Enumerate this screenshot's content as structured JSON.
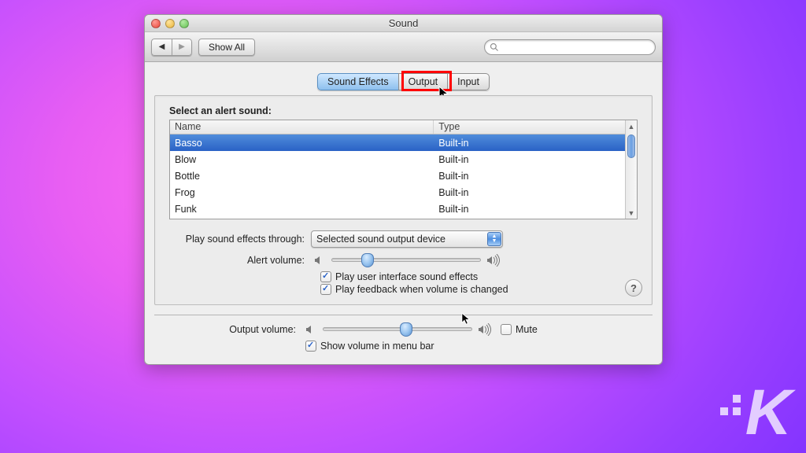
{
  "window": {
    "title": "Sound"
  },
  "toolbar": {
    "show_all": "Show All",
    "search_placeholder": ""
  },
  "tabs": {
    "items": [
      {
        "label": "Sound Effects",
        "active": true
      },
      {
        "label": "Output",
        "active": false
      },
      {
        "label": "Input",
        "active": false
      }
    ]
  },
  "section": {
    "alert_heading": "Select an alert sound:"
  },
  "columns": {
    "name": "Name",
    "type": "Type"
  },
  "alerts": [
    {
      "name": "Basso",
      "type": "Built-in",
      "selected": true
    },
    {
      "name": "Blow",
      "type": "Built-in",
      "selected": false
    },
    {
      "name": "Bottle",
      "type": "Built-in",
      "selected": false
    },
    {
      "name": "Frog",
      "type": "Built-in",
      "selected": false
    },
    {
      "name": "Funk",
      "type": "Built-in",
      "selected": false
    }
  ],
  "labels": {
    "play_through": "Play sound effects through:",
    "alert_volume": "Alert volume:",
    "output_volume": "Output volume:"
  },
  "popup": {
    "selected": "Selected sound output device"
  },
  "checks": {
    "ui_effects": "Play user interface sound effects",
    "volume_feedback": "Play feedback when volume is changed",
    "mute": "Mute",
    "show_menu": "Show volume in menu bar"
  },
  "help": "?"
}
